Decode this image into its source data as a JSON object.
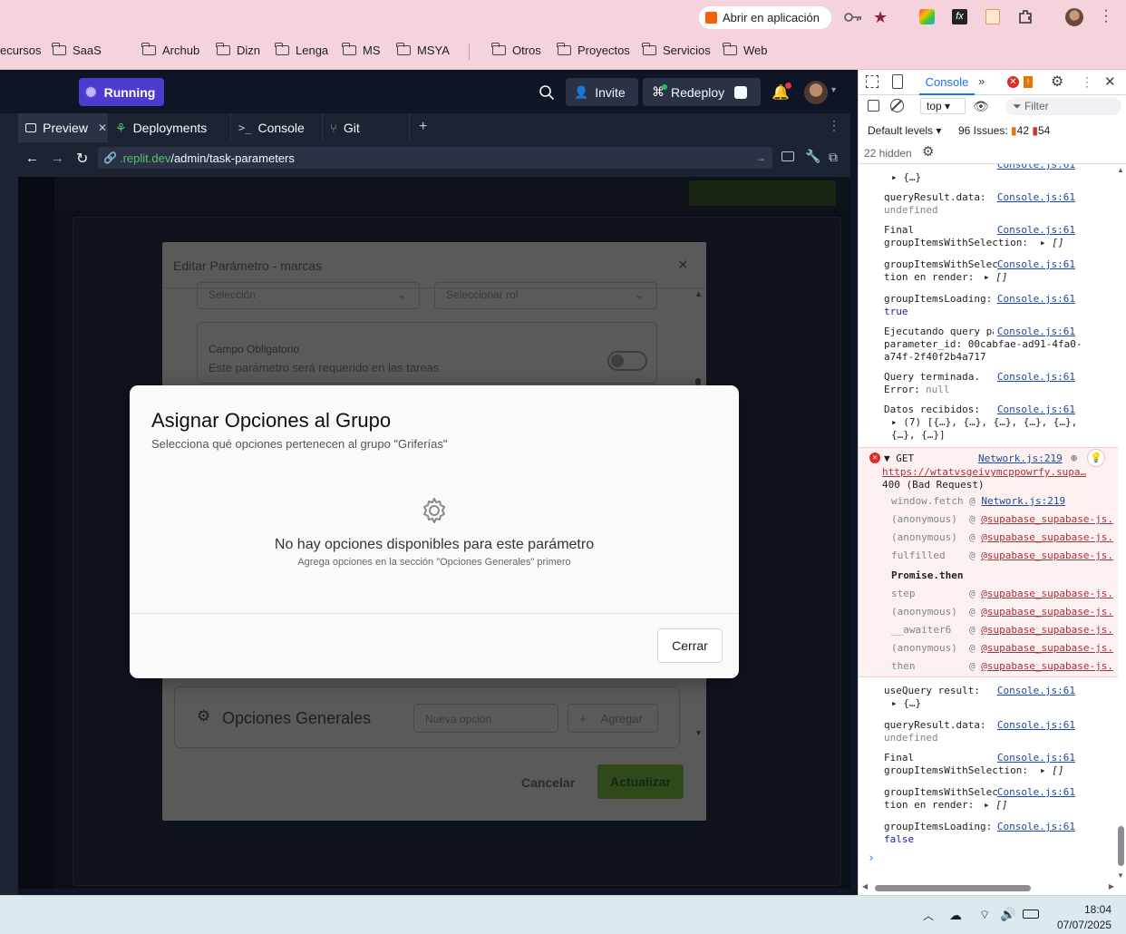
{
  "chrome": {
    "open_in_app": "Abrir en aplicación",
    "bookmarks": [
      "ecursos",
      "SaaS",
      "Archub",
      "Dizn",
      "Lenga",
      "MS",
      "MSYA",
      "Otros",
      "Proyectos",
      "Servicios",
      "Web"
    ]
  },
  "replit": {
    "status": "Running",
    "invite": "Invite",
    "redeploy": "Redeploy",
    "tabs": [
      "Preview",
      "Deployments",
      "Console",
      "Git"
    ],
    "url_host": ".replit.dev",
    "url_path": "/admin/task-parameters"
  },
  "edit_modal": {
    "title": "Editar Parámetro - marcas",
    "select1": "Selección",
    "select2": "Seleccionar rol",
    "required_label": "Campo Obligatorio",
    "required_desc": "Este parámetro será requerido en las tareas",
    "general_options": "Opciones Generales",
    "new_option_placeholder": "Nueva opción",
    "add": "Agregar",
    "cancel": "Cancelar",
    "update": "Actualizar"
  },
  "dialog": {
    "title": "Asignar Opciones al Grupo",
    "subtitle": "Selecciona qué opciones pertenecen al grupo \"Griferías\"",
    "empty_title": "No hay opciones disponibles para este parámetro",
    "empty_hint": "Agrega opciones en la sección \"Opciones Generales\" primero",
    "close": "Cerrar"
  },
  "devtools": {
    "tab": "Console",
    "context": "top",
    "filter_placeholder": "Filter",
    "default_levels": "Default levels",
    "issues_label": "96 Issues:",
    "issues_warn": "42",
    "issues_info": "54",
    "hidden": "22 hidden",
    "src_console": "Console.js:61",
    "src_network": "Network.js:219",
    "logs_top": [
      {
        "text": "queryResult.data:",
        "sub": "undefined"
      },
      {
        "text": "Final groupItemsWithSelection:",
        "sub": "▸ []"
      },
      {
        "text": "groupItemsWithSelection en render:",
        "sub": "▸ []"
      },
      {
        "text": "groupItemsLoading:",
        "sub": "true"
      },
      {
        "text": "Ejecutando query para parameter_id: 00cabfae-ad91-4fa0-a74f-2f40f2b4a717",
        "sub": ""
      },
      {
        "text": "Query terminada. Error:",
        "sub": "null"
      },
      {
        "text": "Datos recibidos:",
        "sub": "▸ (7) [{…}, {…}, {…}, {…}, {…}, {…}, {…}]"
      }
    ],
    "error": {
      "method": "▼ GET",
      "url": "https://wtatvsgeivymcppowrfy.supa…",
      "status": "400 (Bad Request)",
      "stack": [
        {
          "fn": "window.fetch",
          "at": "Network.js:219"
        },
        {
          "fn": "(anonymous)",
          "at": "@supabase_supabase-js."
        },
        {
          "fn": "(anonymous)",
          "at": "@supabase_supabase-js."
        },
        {
          "fn": "fulfilled",
          "at": "@supabase_supabase-js."
        },
        {
          "fn": "Promise.then",
          "at": ""
        },
        {
          "fn": "step",
          "at": "@supabase_supabase-js."
        },
        {
          "fn": "(anonymous)",
          "at": "@supabase_supabase-js."
        },
        {
          "fn": "__awaiter6",
          "at": "@supabase_supabase-js."
        },
        {
          "fn": "(anonymous)",
          "at": "@supabase_supabase-js."
        },
        {
          "fn": "then",
          "at": "@supabase_supabase-js."
        }
      ]
    },
    "logs_bottom": [
      {
        "text": "useQuery result:",
        "sub": "▸ {…}"
      },
      {
        "text": "queryResult.data:",
        "sub": "undefined"
      },
      {
        "text": "Final groupItemsWithSelection:",
        "sub": "▸ []"
      },
      {
        "text": "groupItemsWithSelection en render:",
        "sub": "▸ []"
      },
      {
        "text": "groupItemsLoading:",
        "sub": "false"
      }
    ],
    "partial_top": "▸ {…}"
  },
  "taskbar": {
    "time": "18:04",
    "date": "07/07/2025"
  }
}
